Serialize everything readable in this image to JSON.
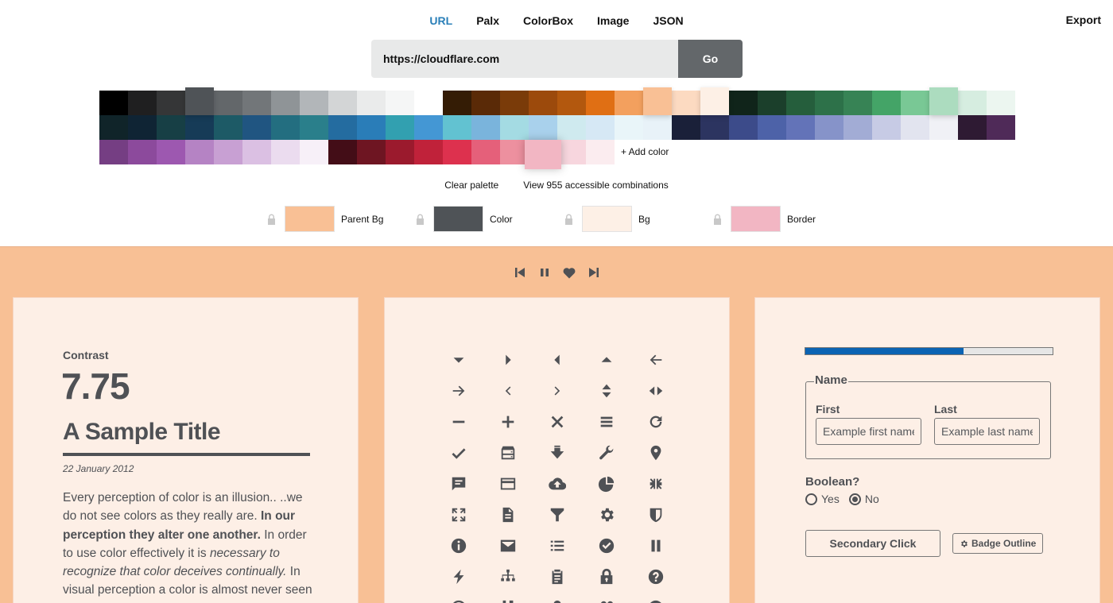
{
  "nav": {
    "tabs": [
      {
        "label": "URL",
        "active": true
      },
      {
        "label": "Palx",
        "active": false
      },
      {
        "label": "ColorBox",
        "active": false
      },
      {
        "label": "Image",
        "active": false
      },
      {
        "label": "JSON",
        "active": false
      }
    ],
    "export_label": "Export"
  },
  "url_form": {
    "value": "https://cloudflare.com",
    "go_label": "Go"
  },
  "palette": {
    "rows": [
      [
        "#000000",
        "#1f1f20",
        "#353637",
        "#4f5357",
        "#63676a",
        "#727679",
        "#8f9497",
        "#b2b6b9",
        "#d3d5d6",
        "#eaebeb",
        "#f5f6f6",
        "#ffffff",
        "#341c05",
        "#5a2a07",
        "#7a3b09",
        "#9c4a0c",
        "#b3580e",
        "#e06f14",
        "#f3a05e",
        "#f9c095",
        "#fcdac1",
        "#fdf0e6",
        "#10241a",
        "#1b3f2b",
        "#255e3c",
        "#2d7149",
        "#378355",
        "#44a467",
        "#79c895",
        "#acdcbf",
        "#d6ede0",
        "#ecf6f0"
      ],
      [
        "#102429",
        "#0f2434",
        "#173f45",
        "#163b57",
        "#1d5a66",
        "#205581",
        "#236e80",
        "#2a7f8b",
        "#246ca0",
        "#2a7db8",
        "#32a0b0",
        "#4497d4",
        "#62c2d1",
        "#7ab4dc",
        "#a4dbe3",
        "#a9d1ec",
        "#cfeaef",
        "#d6e8f5",
        "#e9f5f9",
        "#e8f2f8",
        "#1a2039",
        "#2c3460",
        "#3c4b8a",
        "#4d62a8",
        "#6373b8",
        "#8693c9",
        "#a2acd5",
        "#c7cbe5",
        "#e2e4ef",
        "#f0f1f6",
        "#2e1a33",
        "#4f2a58"
      ],
      [
        "#753e83",
        "#8c4a9c",
        "#9d58b0",
        "#b583c4",
        "#c8a0d3",
        "#dbc0e3",
        "#ebdcef",
        "#f7f0f8",
        "#430d17",
        "#6e1522",
        "#9b1a2d",
        "#c0223a",
        "#dd314e",
        "#e5607a",
        "#ed909f",
        "#f2b6c3",
        "#f7d6de",
        "#fbecef"
      ]
    ],
    "add_color_label": "+ Add color"
  },
  "actions": {
    "clear_label": "Clear palette",
    "combos_label": "View 955 accessible combinations"
  },
  "roles": [
    {
      "label": "Parent Bg",
      "color": "#f9c095",
      "icon": "lock-icon"
    },
    {
      "label": "Color",
      "color": "#4f5357",
      "icon": "lock-icon"
    },
    {
      "label": "Bg",
      "color": "#fdf0e6",
      "icon": "lock-icon"
    },
    {
      "label": "Border",
      "color": "#f2b6c3",
      "icon": "lock-icon"
    }
  ],
  "player": {
    "buttons": [
      "skip-back-icon",
      "pause-icon",
      "heart-icon",
      "skip-forward-icon"
    ]
  },
  "preview": {
    "colors": {
      "parent_bg": "#f9c095",
      "bg": "#fdefe6",
      "text": "#4f5155",
      "accent": "#0b63b3"
    },
    "contrast_label": "Contrast",
    "contrast_value": "7.75",
    "title": "A Sample Title",
    "date": "22 January 2012",
    "paragraph": {
      "p1": "Every perception of color is an illusion.. ..we do not see colors as they really are. ",
      "p2_bold": "In our perception they alter one another.",
      "p3": " In order to use color effectively it is ",
      "p4_italic": "necessary to recognize that color deceives continually.",
      "p5": " In visual perception a color is almost never seen as it really is — as it physically is."
    },
    "icons": [
      "triangle-down-icon",
      "triangle-right-icon",
      "triangle-left-icon",
      "triangle-up-icon",
      "arrow-left-icon",
      "arrow-right-icon",
      "chevron-left-icon",
      "chevron-right-icon",
      "sort-vertical-icon",
      "sort-horizontal-icon",
      "minus-icon",
      "plus-icon",
      "close-icon",
      "menu-icon",
      "refresh-icon",
      "check-icon",
      "server-icon",
      "download-icon",
      "wrench-icon",
      "map-pin-icon",
      "chat-icon",
      "credit-card-icon",
      "cloud-upload-icon",
      "pie-chart-icon",
      "compress-icon",
      "expand-icon",
      "document-icon",
      "filter-icon",
      "gear-icon",
      "shield-icon",
      "info-icon",
      "mail-icon",
      "list-icon",
      "check-circle-icon",
      "pause-icon",
      "lightning-icon",
      "sitemap-icon",
      "clipboard-icon",
      "lock-icon",
      "question-icon",
      "clock-icon",
      "bookmark-icon",
      "user-icon",
      "users-icon",
      "github-icon"
    ],
    "progress": 0.64,
    "form": {
      "legend": "Name",
      "first_label": "First",
      "first_placeholder": "Example first name",
      "last_label": "Last",
      "last_placeholder": "Example last name",
      "boolean_label": "Boolean?",
      "radio_yes": "Yes",
      "radio_no": "No",
      "selected": "No",
      "secondary_button": "Secondary Click",
      "badge_button": "Badge Outline"
    }
  }
}
